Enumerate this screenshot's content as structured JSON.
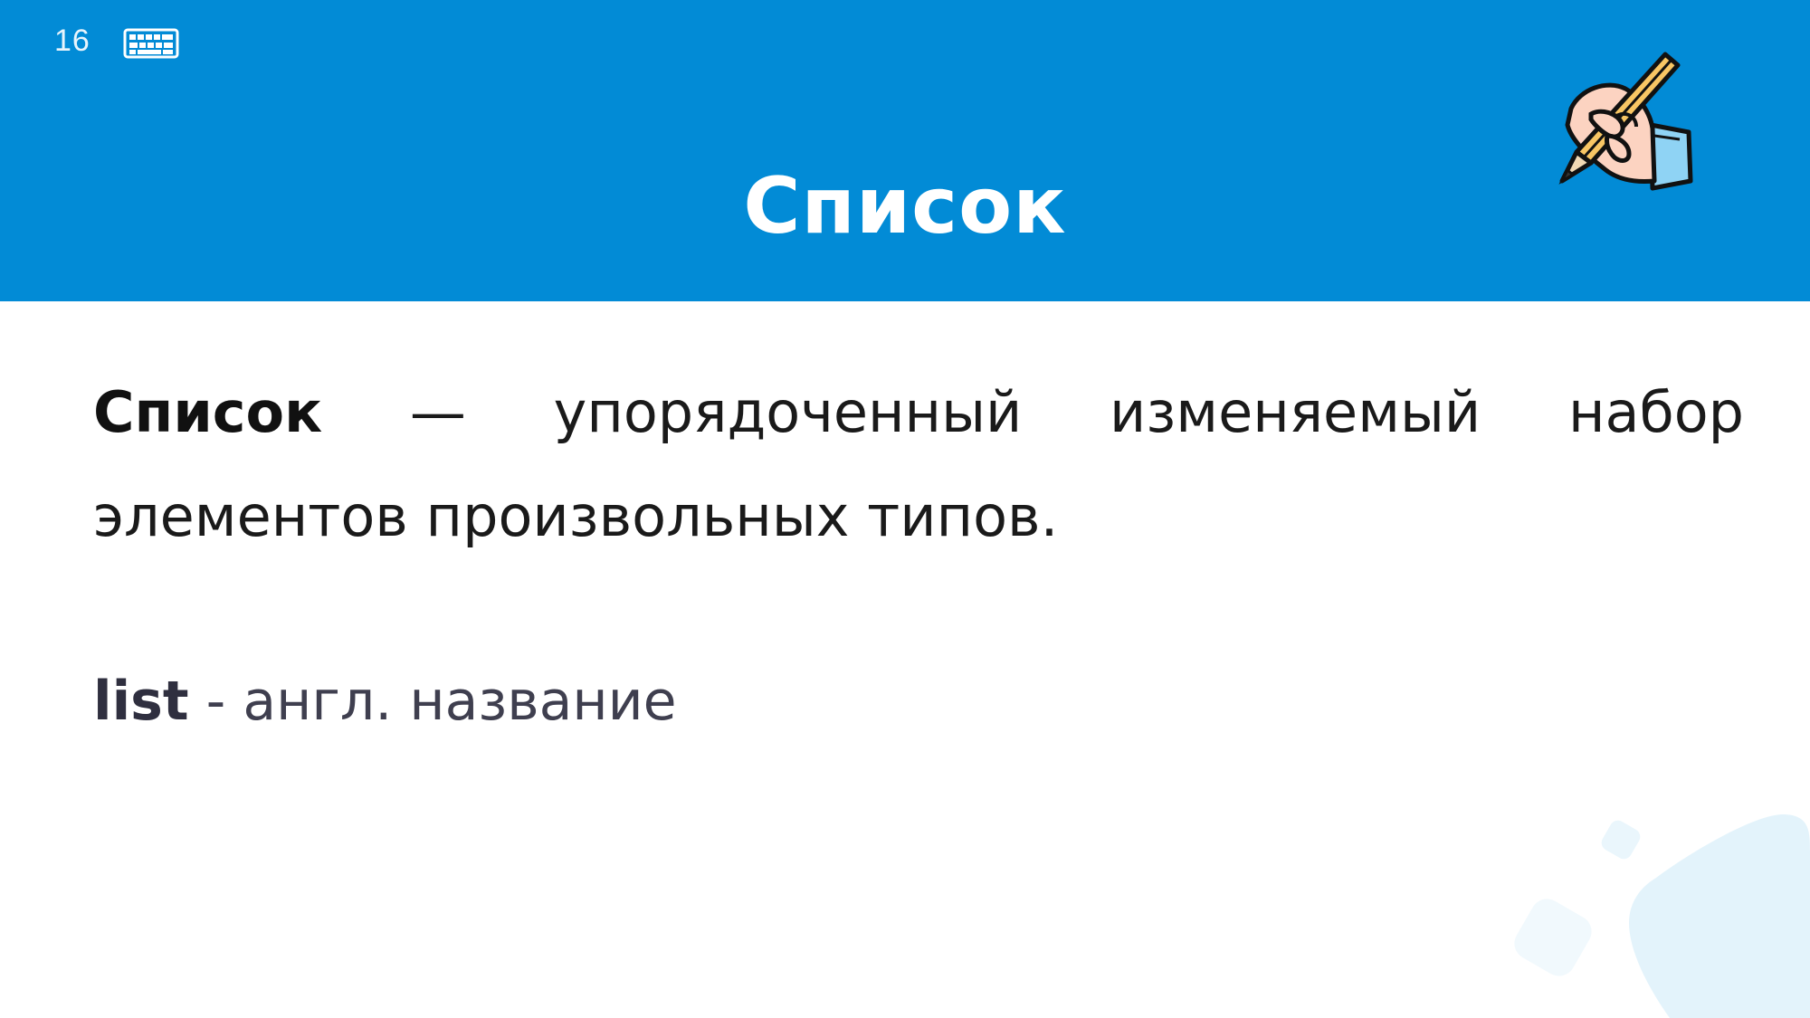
{
  "slide": {
    "number": "16",
    "title": "Список"
  },
  "definition": {
    "term": "Список",
    "dash": "—",
    "line1_words": [
      "упорядоченный",
      "изменяемый",
      "набор"
    ],
    "line2": "элементов произвольных типов."
  },
  "english_name": {
    "term": "list",
    "description": "- англ. название"
  },
  "colors": {
    "header": "#028bd6",
    "title": "#ffffff",
    "body_text": "#1a1a1a",
    "secondary_text": "#3f3f4f",
    "decor": "#e3f3fb"
  },
  "icons": {
    "header_left": "keyboard-icon",
    "header_right": "hand-writing-pencil-icon"
  }
}
